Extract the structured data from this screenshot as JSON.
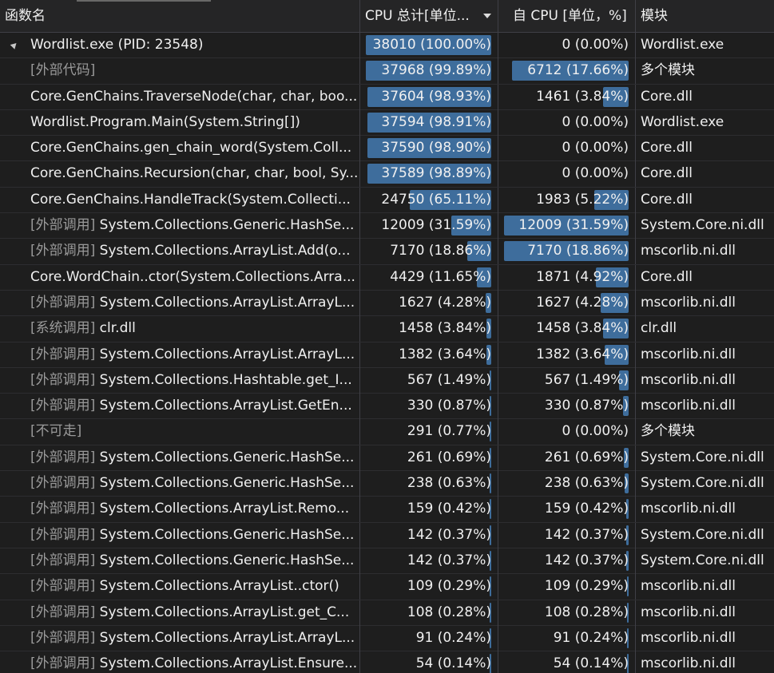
{
  "columns": {
    "name": "函数名",
    "total": "CPU 总计[单位...",
    "self": "自 CPU [单位，%]",
    "module": "模块"
  },
  "colors": {
    "bar": "#3e6d9c",
    "background": "#1e1e1e"
  },
  "rows": [
    {
      "prefix": "",
      "name": "Wordlist.exe (PID: 23548)",
      "total": "38010 (100.00%)",
      "total_pct": 100.0,
      "self": "0 (0.00%)",
      "self_pct": 0.0,
      "module": "Wordlist.exe",
      "expander": true
    },
    {
      "prefix": "[外部代码]",
      "name": "",
      "total": "37968 (99.89%)",
      "total_pct": 99.89,
      "self": "6712 (17.66%)",
      "self_pct": 17.66,
      "module": "多个模块"
    },
    {
      "prefix": "",
      "name": "Core.GenChains.TraverseNode(char, char, boo...",
      "total": "37604 (98.93%)",
      "total_pct": 98.93,
      "self": "1461 (3.84%)",
      "self_pct": 3.84,
      "module": "Core.dll"
    },
    {
      "prefix": "",
      "name": "Wordlist.Program.Main(System.String[])",
      "total": "37594 (98.91%)",
      "total_pct": 98.91,
      "self": "0 (0.00%)",
      "self_pct": 0.0,
      "module": "Wordlist.exe"
    },
    {
      "prefix": "",
      "name": "Core.GenChains.gen_chain_word(System.Coll...",
      "total": "37590 (98.90%)",
      "total_pct": 98.9,
      "self": "0 (0.00%)",
      "self_pct": 0.0,
      "module": "Core.dll"
    },
    {
      "prefix": "",
      "name": "Core.GenChains.Recursion(char, char, bool, Sy...",
      "total": "37589 (98.89%)",
      "total_pct": 98.89,
      "self": "0 (0.00%)",
      "self_pct": 0.0,
      "module": "Core.dll"
    },
    {
      "prefix": "",
      "name": "Core.GenChains.HandleTrack(System.Collecti...",
      "total": "24750 (65.11%)",
      "total_pct": 65.11,
      "self": "1983 (5.22%)",
      "self_pct": 5.22,
      "module": "Core.dll"
    },
    {
      "prefix": "[外部调用]",
      "name": "System.Collections.Generic.HashSe...",
      "total": "12009 (31.59%)",
      "total_pct": 31.59,
      "self": "12009 (31.59%)",
      "self_pct": 31.59,
      "module": "System.Core.ni.dll"
    },
    {
      "prefix": "[外部调用]",
      "name": "System.Collections.ArrayList.Add(o...",
      "total": "7170 (18.86%)",
      "total_pct": 18.86,
      "self": "7170 (18.86%)",
      "self_pct": 18.86,
      "module": "mscorlib.ni.dll"
    },
    {
      "prefix": "",
      "name": "Core.WordChain..ctor(System.Collections.Arra...",
      "total": "4429 (11.65%)",
      "total_pct": 11.65,
      "self": "1871 (4.92%)",
      "self_pct": 4.92,
      "module": "Core.dll"
    },
    {
      "prefix": "[外部调用]",
      "name": "System.Collections.ArrayList.ArrayL...",
      "total": "1627 (4.28%)",
      "total_pct": 4.28,
      "self": "1627 (4.28%)",
      "self_pct": 4.28,
      "module": "mscorlib.ni.dll"
    },
    {
      "prefix": "[系统调用]",
      "name": "clr.dll",
      "total": "1458 (3.84%)",
      "total_pct": 3.84,
      "self": "1458 (3.84%)",
      "self_pct": 3.84,
      "module": "clr.dll"
    },
    {
      "prefix": "[外部调用]",
      "name": "System.Collections.ArrayList.ArrayL...",
      "total": "1382 (3.64%)",
      "total_pct": 3.64,
      "self": "1382 (3.64%)",
      "self_pct": 3.64,
      "module": "mscorlib.ni.dll"
    },
    {
      "prefix": "[外部调用]",
      "name": "System.Collections.Hashtable.get_I...",
      "total": "567 (1.49%)",
      "total_pct": 1.49,
      "self": "567 (1.49%)",
      "self_pct": 1.49,
      "module": "mscorlib.ni.dll"
    },
    {
      "prefix": "[外部调用]",
      "name": "System.Collections.ArrayList.GetEn...",
      "total": "330 (0.87%)",
      "total_pct": 0.87,
      "self": "330 (0.87%)",
      "self_pct": 0.87,
      "module": "mscorlib.ni.dll"
    },
    {
      "prefix": "[不可走]",
      "name": "",
      "total": "291 (0.77%)",
      "total_pct": 0.77,
      "self": "0 (0.00%)",
      "self_pct": 0.0,
      "module": "多个模块"
    },
    {
      "prefix": "[外部调用]",
      "name": "System.Collections.Generic.HashSe...",
      "total": "261 (0.69%)",
      "total_pct": 0.69,
      "self": "261 (0.69%)",
      "self_pct": 0.69,
      "module": "System.Core.ni.dll"
    },
    {
      "prefix": "[外部调用]",
      "name": "System.Collections.Generic.HashSe...",
      "total": "238 (0.63%)",
      "total_pct": 0.63,
      "self": "238 (0.63%)",
      "self_pct": 0.63,
      "module": "System.Core.ni.dll"
    },
    {
      "prefix": "[外部调用]",
      "name": "System.Collections.ArrayList.Remo...",
      "total": "159 (0.42%)",
      "total_pct": 0.42,
      "self": "159 (0.42%)",
      "self_pct": 0.42,
      "module": "mscorlib.ni.dll"
    },
    {
      "prefix": "[外部调用]",
      "name": "System.Collections.Generic.HashSe...",
      "total": "142 (0.37%)",
      "total_pct": 0.37,
      "self": "142 (0.37%)",
      "self_pct": 0.37,
      "module": "System.Core.ni.dll"
    },
    {
      "prefix": "[外部调用]",
      "name": "System.Collections.Generic.HashSe...",
      "total": "142 (0.37%)",
      "total_pct": 0.37,
      "self": "142 (0.37%)",
      "self_pct": 0.37,
      "module": "System.Core.ni.dll"
    },
    {
      "prefix": "[外部调用]",
      "name": "System.Collections.ArrayList..ctor()",
      "total": "109 (0.29%)",
      "total_pct": 0.29,
      "self": "109 (0.29%)",
      "self_pct": 0.29,
      "module": "mscorlib.ni.dll"
    },
    {
      "prefix": "[外部调用]",
      "name": "System.Collections.ArrayList.get_C...",
      "total": "108 (0.28%)",
      "total_pct": 0.28,
      "self": "108 (0.28%)",
      "self_pct": 0.28,
      "module": "mscorlib.ni.dll"
    },
    {
      "prefix": "[外部调用]",
      "name": "System.Collections.ArrayList.ArrayL...",
      "total": "91 (0.24%)",
      "total_pct": 0.24,
      "self": "91 (0.24%)",
      "self_pct": 0.24,
      "module": "mscorlib.ni.dll"
    },
    {
      "prefix": "[外部调用]",
      "name": "System.Collections.ArrayList.Ensure...",
      "total": "54 (0.14%)",
      "total_pct": 0.14,
      "self": "54 (0.14%)",
      "self_pct": 0.14,
      "module": "mscorlib.ni.dll"
    }
  ]
}
